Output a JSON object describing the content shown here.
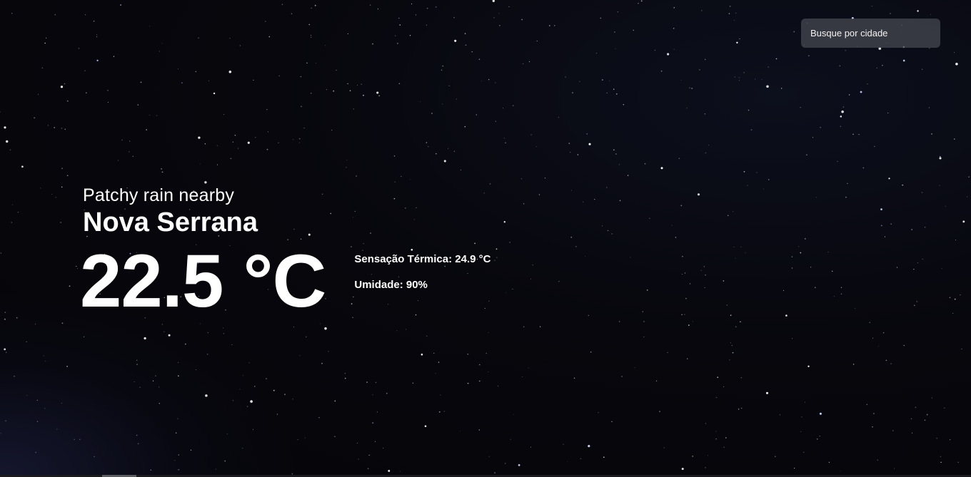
{
  "search": {
    "placeholder": "Busque por cidade"
  },
  "weather": {
    "condition": "Patchy rain nearby",
    "city": "Nova Serrana",
    "temperature": "22.5 °C",
    "feels_like_label": "Sensação Térmica:",
    "feels_like_value": "24.9 °C",
    "humidity_label": "Umidade:",
    "humidity_value": "90%"
  },
  "background": {
    "image": "starry night sky",
    "base_color": "#07070d"
  }
}
